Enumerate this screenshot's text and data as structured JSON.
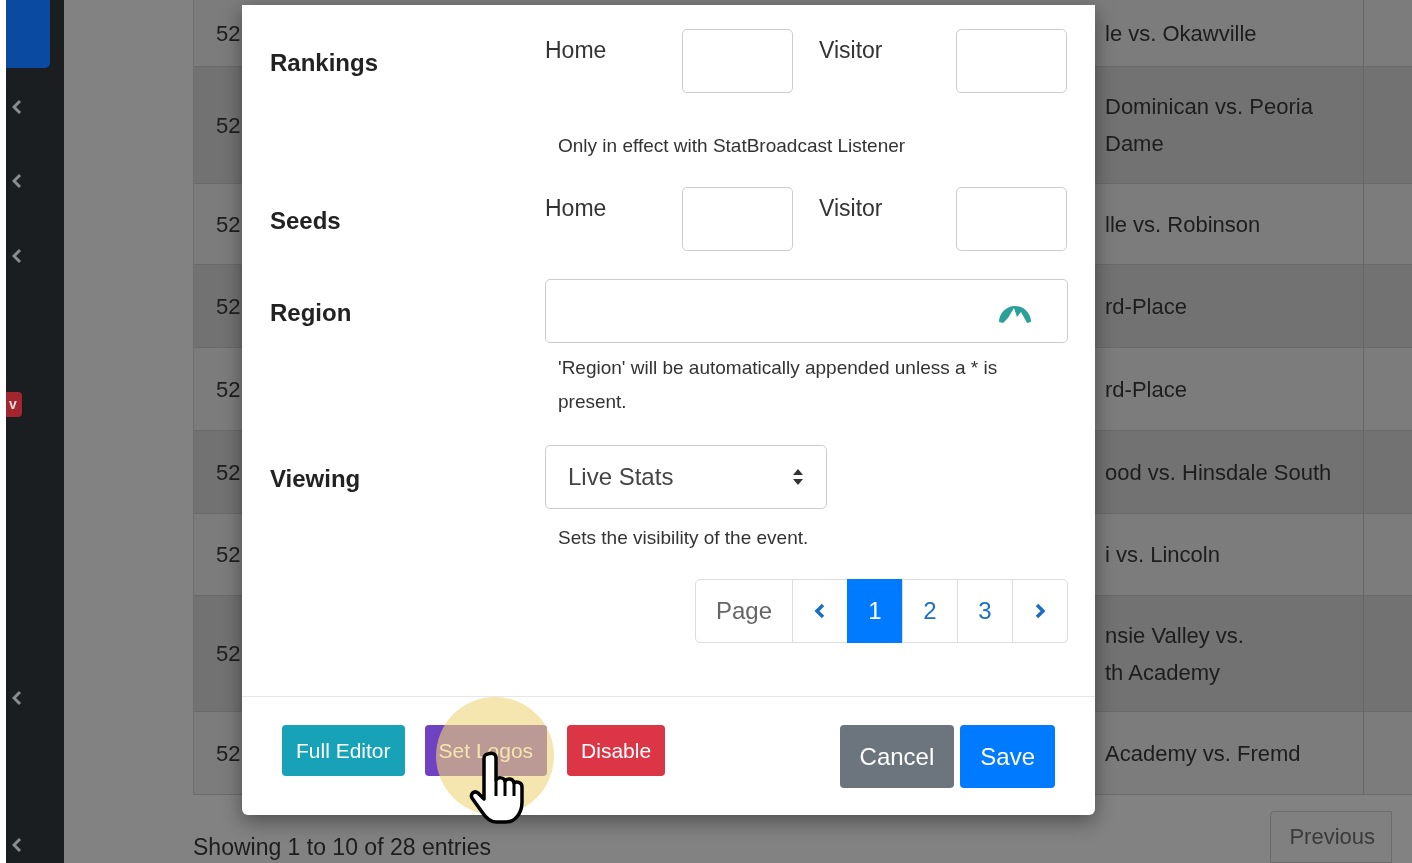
{
  "sidebar": {
    "badge": "v"
  },
  "table": {
    "rows": [
      {
        "id": "52",
        "match": [
          "le vs. Okawville"
        ]
      },
      {
        "id": "52",
        "match": [
          "Dominican vs. Peoria",
          "Dame"
        ]
      },
      {
        "id": "52",
        "match": [
          "lle vs. Robinson"
        ]
      },
      {
        "id": "52",
        "match": [
          "rd-Place"
        ]
      },
      {
        "id": "52",
        "match": [
          "rd-Place"
        ]
      },
      {
        "id": "52",
        "match": [
          "ood vs. Hinsdale South"
        ]
      },
      {
        "id": "52",
        "match": [
          "i vs. Lincoln"
        ]
      },
      {
        "id": "52",
        "match": [
          "nsie Valley vs.",
          "th Academy"
        ]
      },
      {
        "id": "52",
        "match": [
          "Academy vs. Fremd"
        ]
      }
    ],
    "info": "Showing 1 to 10 of 28 entries",
    "previous": "Previous"
  },
  "modal": {
    "fields": [
      {
        "kind": "pair",
        "label": "Rankings",
        "home_label": "Home",
        "visitor_label": "Visitor",
        "help": "Only in effect with StatBroadcast Listener"
      },
      {
        "kind": "pair",
        "label": "Seeds",
        "home_label": "Home",
        "visitor_label": "Visitor"
      },
      {
        "kind": "text",
        "label": "Region",
        "help": "'Region' will be automatically appended unless a * is present."
      },
      {
        "kind": "select",
        "label": "Viewing",
        "value": "Live Stats",
        "help": "Sets the visibility of the event."
      }
    ],
    "pagination": {
      "label": "Page",
      "pages": [
        {
          "label": "1",
          "selected": true
        },
        {
          "label": "2",
          "selected": false
        },
        {
          "label": "3",
          "selected": false
        }
      ]
    },
    "left_buttons": [
      {
        "label": "Full Editor",
        "kind": "info"
      },
      {
        "label": "Set Logos",
        "kind": "purple"
      },
      {
        "label": "Disable",
        "kind": "danger"
      }
    ],
    "right_buttons": [
      {
        "label": "Cancel",
        "kind": "secondary"
      },
      {
        "label": "Save",
        "kind": "primary"
      }
    ]
  }
}
